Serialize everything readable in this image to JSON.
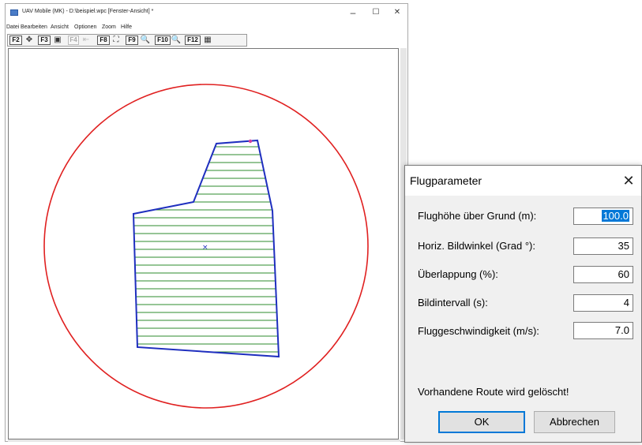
{
  "window": {
    "title": "UAV Mobile (MK) - D:\\beispiel.wpc  [Fenster-Ansicht] *",
    "minimize": "–",
    "maximize": "☐",
    "close": "✕"
  },
  "menu": [
    "Datei",
    "Bearbeiten",
    "Ansicht",
    "Optionen",
    "Zoom",
    "Hilfe"
  ],
  "toolbar": {
    "f2": "F2",
    "f3": "F3",
    "f4": "F4",
    "f8": "F8",
    "f9": "F9",
    "f10": "F10",
    "f12": "F12"
  },
  "map": {
    "circle_color": "#e02020",
    "boundary_color": "#1f2fbf",
    "route_color": "#2e8b2e"
  },
  "dialog": {
    "title": "Flugparameter",
    "close": "✕",
    "fields": [
      {
        "label": "Flughöhe über Grund (m):",
        "value": "100.0"
      },
      {
        "label": "Horiz. Bildwinkel (Grad °):",
        "value": "35"
      },
      {
        "label": "Überlappung (%):",
        "value": "60"
      },
      {
        "label": "Bildintervall (s):",
        "value": "4"
      },
      {
        "label": "Fluggeschwindigkeit (m/s):",
        "value": "7.0"
      }
    ],
    "warning": "Vorhandene Route wird gelöscht!",
    "ok": "OK",
    "cancel": "Abbrechen"
  }
}
